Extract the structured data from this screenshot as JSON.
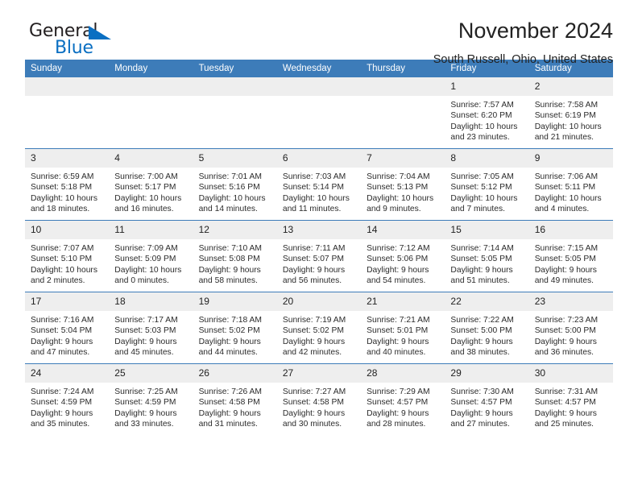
{
  "brand": {
    "name_part1": "General",
    "name_part2": "Blue",
    "logo_icon": "triangle-logo-icon"
  },
  "header": {
    "title": "November 2024",
    "subtitle": "South Russell, Ohio, United States"
  },
  "colors": {
    "header_blue": "#3d7cb9",
    "daynum_gray": "#eeeeee",
    "brand_blue": "#0a6fc2",
    "text": "#222222"
  },
  "weekdays": [
    "Sunday",
    "Monday",
    "Tuesday",
    "Wednesday",
    "Thursday",
    "Friday",
    "Saturday"
  ],
  "labels": {
    "sunrise": "Sunrise:",
    "sunset": "Sunset:",
    "daylight": "Daylight:"
  },
  "weeks": [
    [
      {
        "day": "",
        "empty": true
      },
      {
        "day": "",
        "empty": true
      },
      {
        "day": "",
        "empty": true
      },
      {
        "day": "",
        "empty": true
      },
      {
        "day": "",
        "empty": true
      },
      {
        "day": "1",
        "sunrise": "Sunrise: 7:57 AM",
        "sunset": "Sunset: 6:20 PM",
        "daylight": "Daylight: 10 hours and 23 minutes."
      },
      {
        "day": "2",
        "sunrise": "Sunrise: 7:58 AM",
        "sunset": "Sunset: 6:19 PM",
        "daylight": "Daylight: 10 hours and 21 minutes."
      }
    ],
    [
      {
        "day": "3",
        "sunrise": "Sunrise: 6:59 AM",
        "sunset": "Sunset: 5:18 PM",
        "daylight": "Daylight: 10 hours and 18 minutes."
      },
      {
        "day": "4",
        "sunrise": "Sunrise: 7:00 AM",
        "sunset": "Sunset: 5:17 PM",
        "daylight": "Daylight: 10 hours and 16 minutes."
      },
      {
        "day": "5",
        "sunrise": "Sunrise: 7:01 AM",
        "sunset": "Sunset: 5:16 PM",
        "daylight": "Daylight: 10 hours and 14 minutes."
      },
      {
        "day": "6",
        "sunrise": "Sunrise: 7:03 AM",
        "sunset": "Sunset: 5:14 PM",
        "daylight": "Daylight: 10 hours and 11 minutes."
      },
      {
        "day": "7",
        "sunrise": "Sunrise: 7:04 AM",
        "sunset": "Sunset: 5:13 PM",
        "daylight": "Daylight: 10 hours and 9 minutes."
      },
      {
        "day": "8",
        "sunrise": "Sunrise: 7:05 AM",
        "sunset": "Sunset: 5:12 PM",
        "daylight": "Daylight: 10 hours and 7 minutes."
      },
      {
        "day": "9",
        "sunrise": "Sunrise: 7:06 AM",
        "sunset": "Sunset: 5:11 PM",
        "daylight": "Daylight: 10 hours and 4 minutes."
      }
    ],
    [
      {
        "day": "10",
        "sunrise": "Sunrise: 7:07 AM",
        "sunset": "Sunset: 5:10 PM",
        "daylight": "Daylight: 10 hours and 2 minutes."
      },
      {
        "day": "11",
        "sunrise": "Sunrise: 7:09 AM",
        "sunset": "Sunset: 5:09 PM",
        "daylight": "Daylight: 10 hours and 0 minutes."
      },
      {
        "day": "12",
        "sunrise": "Sunrise: 7:10 AM",
        "sunset": "Sunset: 5:08 PM",
        "daylight": "Daylight: 9 hours and 58 minutes."
      },
      {
        "day": "13",
        "sunrise": "Sunrise: 7:11 AM",
        "sunset": "Sunset: 5:07 PM",
        "daylight": "Daylight: 9 hours and 56 minutes."
      },
      {
        "day": "14",
        "sunrise": "Sunrise: 7:12 AM",
        "sunset": "Sunset: 5:06 PM",
        "daylight": "Daylight: 9 hours and 54 minutes."
      },
      {
        "day": "15",
        "sunrise": "Sunrise: 7:14 AM",
        "sunset": "Sunset: 5:05 PM",
        "daylight": "Daylight: 9 hours and 51 minutes."
      },
      {
        "day": "16",
        "sunrise": "Sunrise: 7:15 AM",
        "sunset": "Sunset: 5:05 PM",
        "daylight": "Daylight: 9 hours and 49 minutes."
      }
    ],
    [
      {
        "day": "17",
        "sunrise": "Sunrise: 7:16 AM",
        "sunset": "Sunset: 5:04 PM",
        "daylight": "Daylight: 9 hours and 47 minutes."
      },
      {
        "day": "18",
        "sunrise": "Sunrise: 7:17 AM",
        "sunset": "Sunset: 5:03 PM",
        "daylight": "Daylight: 9 hours and 45 minutes."
      },
      {
        "day": "19",
        "sunrise": "Sunrise: 7:18 AM",
        "sunset": "Sunset: 5:02 PM",
        "daylight": "Daylight: 9 hours and 44 minutes."
      },
      {
        "day": "20",
        "sunrise": "Sunrise: 7:19 AM",
        "sunset": "Sunset: 5:02 PM",
        "daylight": "Daylight: 9 hours and 42 minutes."
      },
      {
        "day": "21",
        "sunrise": "Sunrise: 7:21 AM",
        "sunset": "Sunset: 5:01 PM",
        "daylight": "Daylight: 9 hours and 40 minutes."
      },
      {
        "day": "22",
        "sunrise": "Sunrise: 7:22 AM",
        "sunset": "Sunset: 5:00 PM",
        "daylight": "Daylight: 9 hours and 38 minutes."
      },
      {
        "day": "23",
        "sunrise": "Sunrise: 7:23 AM",
        "sunset": "Sunset: 5:00 PM",
        "daylight": "Daylight: 9 hours and 36 minutes."
      }
    ],
    [
      {
        "day": "24",
        "sunrise": "Sunrise: 7:24 AM",
        "sunset": "Sunset: 4:59 PM",
        "daylight": "Daylight: 9 hours and 35 minutes."
      },
      {
        "day": "25",
        "sunrise": "Sunrise: 7:25 AM",
        "sunset": "Sunset: 4:59 PM",
        "daylight": "Daylight: 9 hours and 33 minutes."
      },
      {
        "day": "26",
        "sunrise": "Sunrise: 7:26 AM",
        "sunset": "Sunset: 4:58 PM",
        "daylight": "Daylight: 9 hours and 31 minutes."
      },
      {
        "day": "27",
        "sunrise": "Sunrise: 7:27 AM",
        "sunset": "Sunset: 4:58 PM",
        "daylight": "Daylight: 9 hours and 30 minutes."
      },
      {
        "day": "28",
        "sunrise": "Sunrise: 7:29 AM",
        "sunset": "Sunset: 4:57 PM",
        "daylight": "Daylight: 9 hours and 28 minutes."
      },
      {
        "day": "29",
        "sunrise": "Sunrise: 7:30 AM",
        "sunset": "Sunset: 4:57 PM",
        "daylight": "Daylight: 9 hours and 27 minutes."
      },
      {
        "day": "30",
        "sunrise": "Sunrise: 7:31 AM",
        "sunset": "Sunset: 4:57 PM",
        "daylight": "Daylight: 9 hours and 25 minutes."
      }
    ]
  ]
}
